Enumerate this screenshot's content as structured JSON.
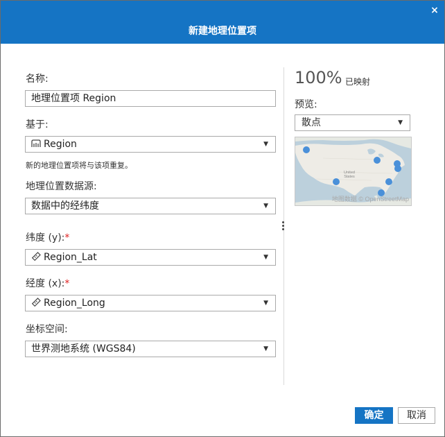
{
  "dialog": {
    "title": "新建地理位置项",
    "close_glyph": "×"
  },
  "form": {
    "name_label": "名称:",
    "name_value": "地理位置项 Region",
    "based_on_label": "基于:",
    "based_on_value": "Region",
    "based_on_icon": "region-field-icon",
    "repeat_note": "新的地理位置项将与该项重复。",
    "source_label": "地理位置数据源:",
    "source_value": "数据中的经纬度",
    "lat_label": "纬度 (y):",
    "lat_value": "Region_Lat",
    "long_label": "经度 (x):",
    "long_value": "Region_Long",
    "required_mark": "*",
    "coord_label": "坐标空间:",
    "coord_value": "世界测地系统 (WGS84)",
    "measure_icon": "ruler-icon"
  },
  "preview": {
    "percent": "100%",
    "mapped_label": "已映射",
    "label": "预览:",
    "type_value": "散点",
    "map_center_label_line1": "United",
    "map_center_label_line2": "States",
    "attribution": "地图数据 © OpenStreetMap",
    "point_color": "#4a90d9"
  },
  "buttons": {
    "ok": "确定",
    "cancel": "取消"
  },
  "colors": {
    "accent": "#1574c4",
    "required": "#e02020"
  }
}
